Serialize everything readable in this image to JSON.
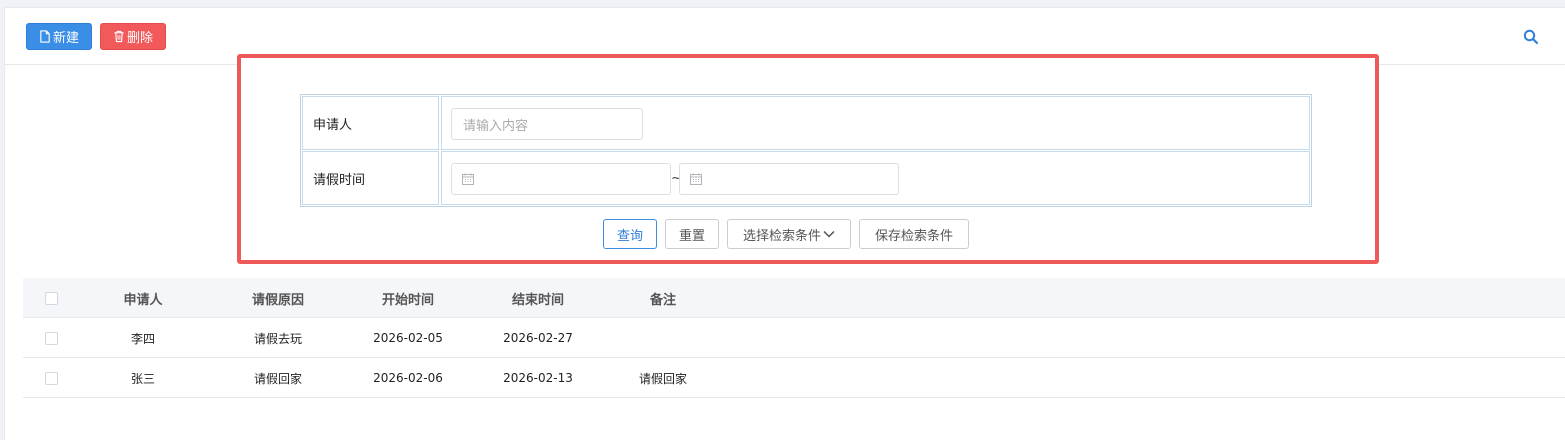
{
  "toolbar": {
    "new_label": "新建",
    "delete_label": "删除",
    "new_icon": "file-icon",
    "delete_icon": "trash-icon",
    "search_icon": "search-icon"
  },
  "search_form": {
    "applicant_label": "申请人",
    "applicant_placeholder": "请输入内容",
    "applicant_value": "",
    "leave_time_label": "请假时间",
    "date_start_value": "",
    "date_end_value": "",
    "range_separator": "~",
    "query_label": "查询",
    "reset_label": "重置",
    "select_conditions_label": "选择检索条件",
    "save_conditions_label": "保存检索条件"
  },
  "table": {
    "columns": [
      "申请人",
      "请假原因",
      "开始时间",
      "结束时间",
      "备注"
    ],
    "rows": [
      {
        "applicant": "李四",
        "reason": "请假去玩",
        "start": "2026-02-05",
        "end": "2026-02-27",
        "note": ""
      },
      {
        "applicant": "张三",
        "reason": "请假回家",
        "start": "2026-02-06",
        "end": "2026-02-13",
        "note": "请假回家"
      }
    ]
  },
  "colors": {
    "primary": "#3a8ee6",
    "danger": "#f2595b",
    "highlight_border": "#ee5a5a"
  }
}
